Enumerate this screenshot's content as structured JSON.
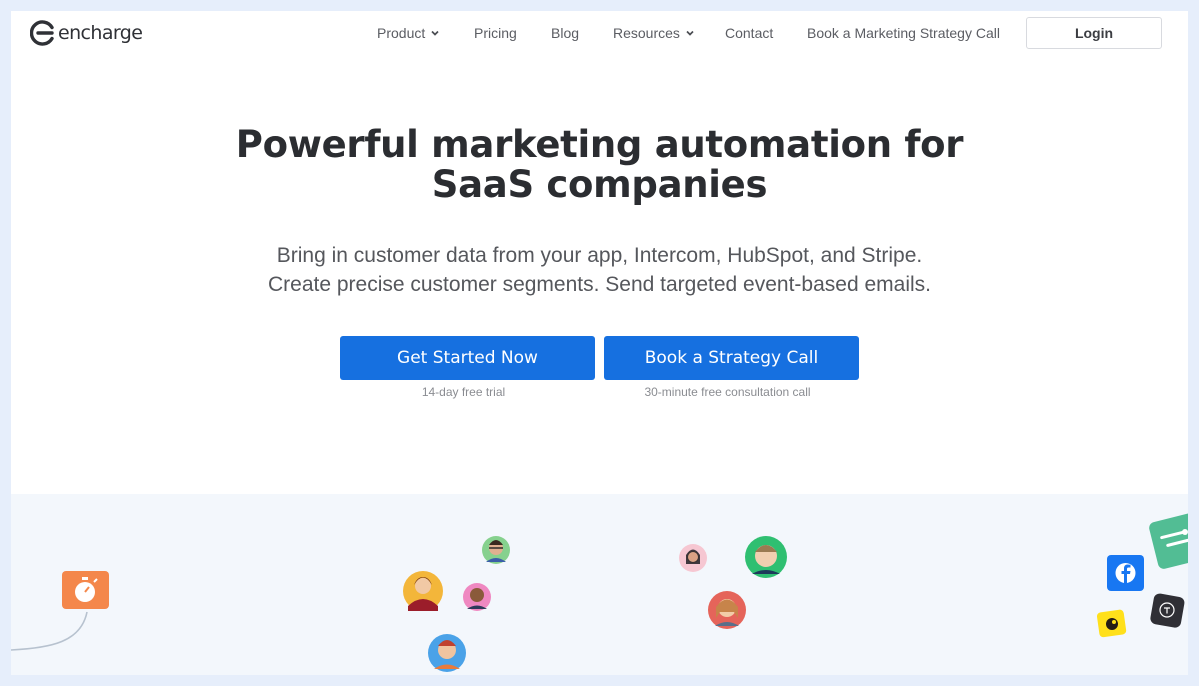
{
  "brand": {
    "name": "encharge"
  },
  "nav": {
    "items": [
      {
        "label": "Product",
        "dropdown": true
      },
      {
        "label": "Pricing",
        "dropdown": false
      },
      {
        "label": "Blog",
        "dropdown": false
      },
      {
        "label": "Resources",
        "dropdown": true
      },
      {
        "label": "Contact",
        "dropdown": false
      },
      {
        "label": "Book a Marketing Strategy Call",
        "dropdown": false
      }
    ],
    "login_label": "Login"
  },
  "hero": {
    "title_line1": "Powerful marketing automation for",
    "title_line2": "SaaS companies",
    "subtitle_line1": "Bring in customer data from your app, Intercom, HubSpot, and Stripe.",
    "subtitle_line2": "Create precise customer segments. Send targeted event-based emails.",
    "primary_cta": {
      "label": "Get Started Now",
      "note": "14-day free trial"
    },
    "secondary_cta": {
      "label": "Book a Strategy Call",
      "note": "30-minute free consultation call"
    }
  },
  "colors": {
    "primary": "#1670e0",
    "text_dark": "#2b2d31",
    "band_bg": "#f3f7fc"
  },
  "illustration_icons": [
    "stopwatch-icon",
    "facebook-icon",
    "intercom-icon",
    "mailchimp-icon",
    "typeform-icon",
    "segment-icon"
  ]
}
